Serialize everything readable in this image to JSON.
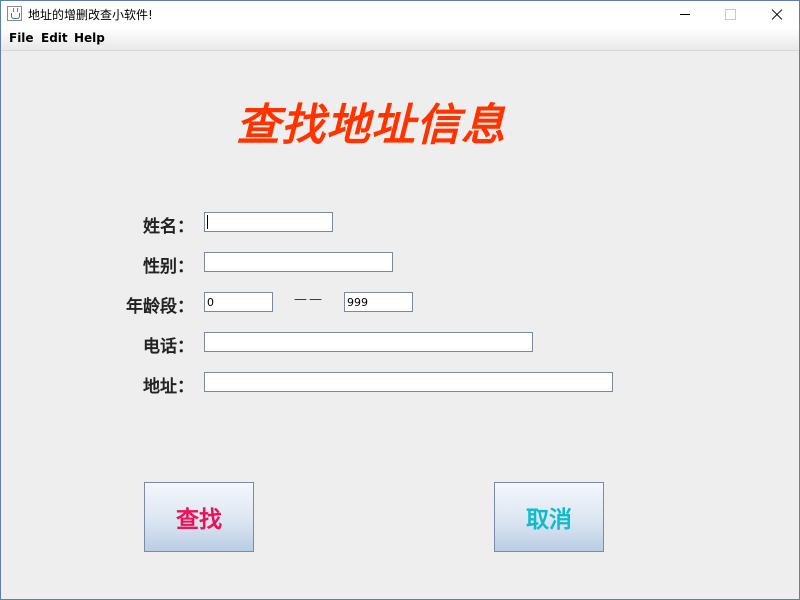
{
  "window": {
    "title": "地址的增删改查小软件!"
  },
  "menu": {
    "items": [
      {
        "label": "File"
      },
      {
        "label": "Edit"
      },
      {
        "label": "Help"
      }
    ]
  },
  "form": {
    "heading": "查找地址信息",
    "name": {
      "label": "姓名：",
      "value": ""
    },
    "gender": {
      "label": "性别：",
      "value": ""
    },
    "age_range": {
      "label": "年龄段：",
      "from": "0",
      "separator": "——",
      "to": "999"
    },
    "phone": {
      "label": "电话：",
      "value": ""
    },
    "address": {
      "label": "地址：",
      "value": ""
    }
  },
  "actions": {
    "search_label": "查找",
    "cancel_label": "取消"
  },
  "colors": {
    "heading": "#ff3300",
    "search_button_text": "#ee1155",
    "cancel_button_text": "#11bbcc"
  }
}
